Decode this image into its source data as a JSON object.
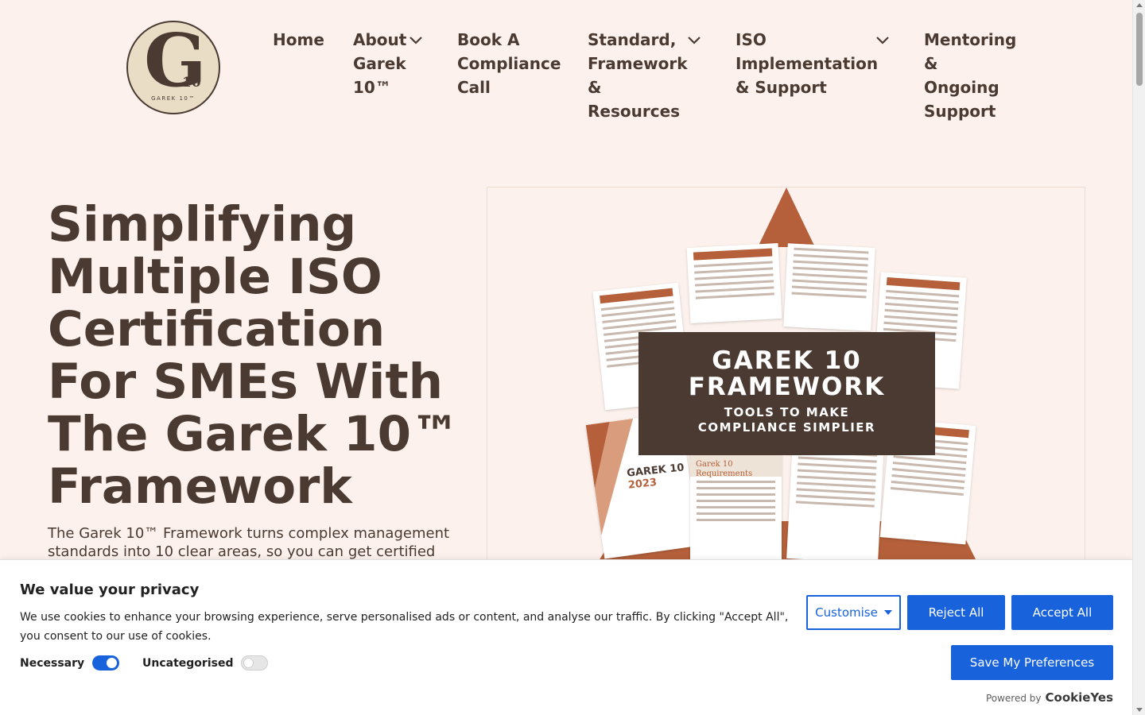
{
  "logo": {
    "letter": "G",
    "sub": "GAREK 10™",
    "ten": "10"
  },
  "nav": {
    "home": "Home",
    "about": [
      "About",
      "Garek",
      "10™"
    ],
    "book": [
      "Book A",
      "Compliance",
      "Call"
    ],
    "standard": [
      "Standard,",
      "Framework",
      "&",
      "Resources"
    ],
    "iso": [
      "ISO",
      "Implementation",
      "& Support"
    ],
    "mentoring": [
      "Mentoring",
      "&",
      "Ongoing",
      "Support"
    ]
  },
  "hero": {
    "title": "Simplifying Multiple ISO Certification For SMEs With The Garek 10™ Framework",
    "subtitle": "The Garek 10™ Framework turns complex management standards into 10 clear areas, so you can get certified",
    "image": {
      "banner_line1": "GAREK 10",
      "banner_line2": "FRAMEWORK",
      "banner_line3": "TOOLS TO MAKE",
      "banner_line4": "COMPLIANCE SIMPLIER",
      "cover_line1": "GAREK 10",
      "cover_line2": "2023",
      "req_line1": "Garek 10",
      "req_line2": "Requirements"
    }
  },
  "cookie": {
    "title": "We value your privacy",
    "text": "We use cookies to enhance your browsing experience, serve personalised ads or content, and analyse our traffic. By clicking \"Accept All\", you consent to our use of cookies.",
    "necessary_label": "Necessary",
    "uncategorised_label": "Uncategorised",
    "customise": "Customise",
    "reject": "Reject All",
    "accept": "Accept All",
    "save": "Save My Preferences",
    "powered_by": "Powered by",
    "brand": "CookieYes"
  },
  "colors": {
    "accent": "#1863dc",
    "brand_dark": "#4a3a32",
    "brand_copper": "#b5603a",
    "background": "#fcf1ec"
  }
}
